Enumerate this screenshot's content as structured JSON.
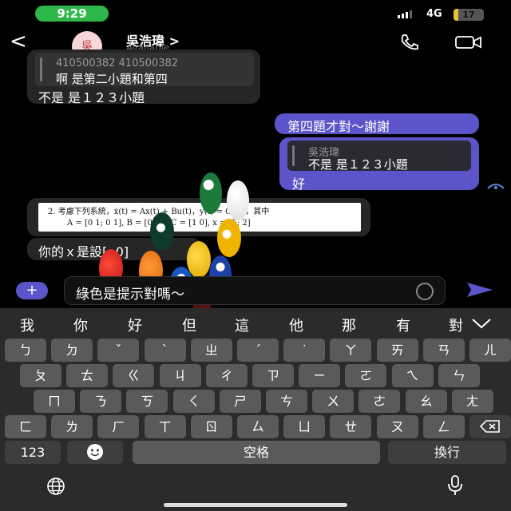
{
  "status": {
    "time": "9:29",
    "network": "4G",
    "battery": "17",
    "battery_level": 0.17
  },
  "header": {
    "contact_name": "吳浩瑋 >",
    "availability": "Available",
    "avatar_initial": "吳"
  },
  "messages": {
    "m1_quote_name": "410500382 410500382",
    "m1_quote_text": "啊 是第二小題和第四",
    "m1_text": "不是 是１２３小題",
    "m2_text": "第四題才對～謝謝",
    "m3_quote_name": "吳浩瑋",
    "m3_quote_text": "不是 是１２３小題",
    "m3_text": "好",
    "m4_image_text": "2.   考慮下列系統，ẋ(t) = Ax(t) + Bu(t)，y(t) = Cx(t)，其中",
    "m4_matrix_text": "A = [0 1; 0 1], B = [0 ...], C = [1  0], x = [5; 2]",
    "m5_text": "你的ｘ是設[ ;0]"
  },
  "composer": {
    "value": "綠色是提示對嗎～"
  },
  "keyboard": {
    "suggestions": [
      "我",
      "你",
      "好",
      "但",
      "這",
      "他",
      "那",
      "有",
      "對"
    ],
    "row1": [
      "ㄅ",
      "ㄉ",
      "ˇ",
      "ˋ",
      "ㄓ",
      "ˊ",
      "˙",
      "ㄚ",
      "ㄞ",
      "ㄢ",
      "ㄦ"
    ],
    "row2": [
      "ㄆ",
      "ㄊ",
      "ㄍ",
      "ㄐ",
      "ㄔ",
      "ㄗ",
      "ㄧ",
      "ㄛ",
      "ㄟ",
      "ㄣ"
    ],
    "row3": [
      "ㄇ",
      "ㄋ",
      "ㄎ",
      "ㄑ",
      "ㄕ",
      "ㄘ",
      "ㄨ",
      "ㄜ",
      "ㄠ",
      "ㄤ"
    ],
    "row4": [
      "ㄈ",
      "ㄌ",
      "ㄏ",
      "ㄒ",
      "ㄖ",
      "ㄙ",
      "ㄩ",
      "ㄝ",
      "ㄡ",
      "ㄥ"
    ],
    "numbers_label": "123",
    "space_label": "空格",
    "return_label": "換行",
    "delete_icon": "backspace-icon"
  },
  "colors": {
    "accent": "#5b55c9",
    "status_green": "#2fb84a",
    "battery": "#e8c232"
  }
}
